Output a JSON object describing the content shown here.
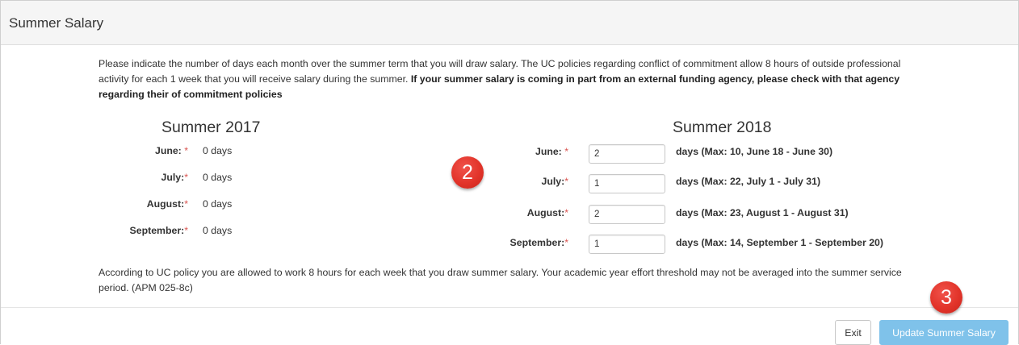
{
  "panel": {
    "title": "Summer Salary"
  },
  "intro": {
    "text": "Please indicate the number of days each month over the summer term that you will draw salary. The UC policies regarding conflict of commitment allow 8 hours of outside professional activity for each 1 week that you will receive salary during the summer. ",
    "bold": "If your summer salary is coming in part from an external funding agency, please check with that agency regarding their of commitment policies"
  },
  "summer2017": {
    "title": "Summer 2017",
    "rows": [
      {
        "label": "June:",
        "req": "*",
        "value": "0 days"
      },
      {
        "label": "July:",
        "req": "*",
        "value": "0 days"
      },
      {
        "label": "August:",
        "req": "*",
        "value": "0 days"
      },
      {
        "label": "September:",
        "req": "*",
        "value": "0 days"
      }
    ]
  },
  "summer2018": {
    "title": "Summer 2018",
    "rows": [
      {
        "label": "June:",
        "req": "*",
        "input": "2",
        "hint": "days (Max: 10, June 18 - June 30)"
      },
      {
        "label": "July:",
        "req": "*",
        "input": "1",
        "hint": "days (Max: 22, July 1 - July 31)"
      },
      {
        "label": "August:",
        "req": "*",
        "input": "2",
        "hint": "days (Max: 23, August 1 - August 31)"
      },
      {
        "label": "September:",
        "req": "*",
        "input": "1",
        "hint": "days (Max: 14, September 1 - September 20)"
      }
    ]
  },
  "policy": {
    "text": "According to UC policy you are allowed to work 8 hours for each week that you draw summer salary. Your academic year effort threshold may not be averaged into the summer service period. (APM 025-8c)"
  },
  "footer": {
    "exit_label": "Exit",
    "update_label": "Update Summer Salary"
  },
  "annotations": {
    "step2": "2",
    "step3": "3"
  },
  "colors": {
    "required": "#d9534f",
    "primary_disabled": "#7fc2ea",
    "badge": "#e2342a"
  }
}
